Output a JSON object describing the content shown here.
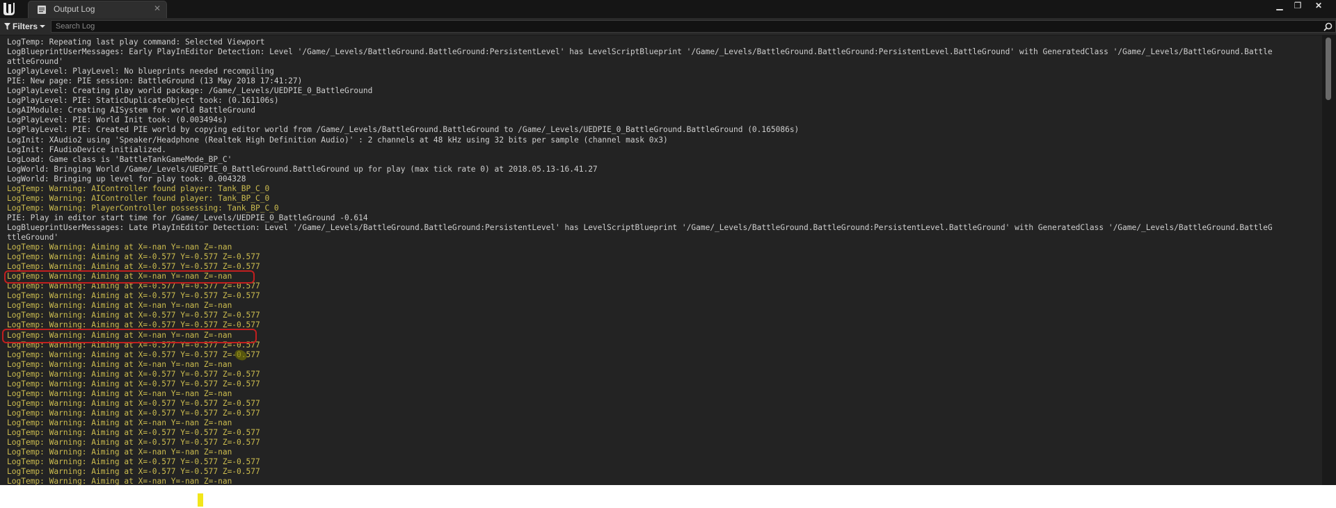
{
  "window": {
    "tab_title": "Output Log",
    "tab_close": "✕",
    "minimize": "▁",
    "restore": "❐",
    "close": "✕"
  },
  "toolbar": {
    "filters_label": "Filters",
    "search_placeholder": "Search Log"
  },
  "colors": {
    "background": "#232323",
    "normal_text": "#cfcfcf",
    "warning_text": "#cdbd4f",
    "highlight": "#c21f1f"
  },
  "log_lines": [
    {
      "text": "LogTemp: Repeating last play command: Selected Viewport",
      "level": "normal"
    },
    {
      "text": "LogBlueprintUserMessages: Early PlayInEditor Detection: Level '/Game/_Levels/BattleGround.BattleGround:PersistentLevel' has LevelScriptBlueprint '/Game/_Levels/BattleGround.BattleGround:PersistentLevel.BattleGround' with GeneratedClass '/Game/_Levels/BattleGround.Battle",
      "level": "normal"
    },
    {
      "text": "attleGround'",
      "level": "normal"
    },
    {
      "text": "LogPlayLevel: PlayLevel: No blueprints needed recompiling",
      "level": "normal"
    },
    {
      "text": "PIE: New page: PIE session: BattleGround (13 May 2018 17:41:27)",
      "level": "normal"
    },
    {
      "text": "LogPlayLevel: Creating play world package: /Game/_Levels/UEDPIE_0_BattleGround",
      "level": "normal"
    },
    {
      "text": "LogPlayLevel: PIE: StaticDuplicateObject took: (0.161106s)",
      "level": "normal"
    },
    {
      "text": "LogAIModule: Creating AISystem for world BattleGround",
      "level": "normal"
    },
    {
      "text": "LogPlayLevel: PIE: World Init took: (0.003494s)",
      "level": "normal"
    },
    {
      "text": "LogPlayLevel: PIE: Created PIE world by copying editor world from /Game/_Levels/BattleGround.BattleGround to /Game/_Levels/UEDPIE_0_BattleGround.BattleGround (0.165086s)",
      "level": "normal"
    },
    {
      "text": "LogInit: XAudio2 using 'Speaker/Headphone (Realtek High Definition Audio)' : 2 channels at 48 kHz using 32 bits per sample (channel mask 0x3)",
      "level": "normal"
    },
    {
      "text": "LogInit: FAudioDevice initialized.",
      "level": "normal"
    },
    {
      "text": "LogLoad: Game class is 'BattleTankGameMode_BP_C'",
      "level": "normal"
    },
    {
      "text": "LogWorld: Bringing World /Game/_Levels/UEDPIE_0_BattleGround.BattleGround up for play (max tick rate 0) at 2018.05.13-16.41.27",
      "level": "normal"
    },
    {
      "text": "LogWorld: Bringing up level for play took: 0.004328",
      "level": "normal"
    },
    {
      "text": "LogTemp: Warning: AIController found player: Tank_BP_C_0",
      "level": "warning"
    },
    {
      "text": "LogTemp: Warning: AIController found player: Tank_BP_C_0",
      "level": "warning"
    },
    {
      "text": "LogTemp: Warning: PlayerController possessing: Tank_BP_C_0",
      "level": "warning"
    },
    {
      "text": "PIE: Play in editor start time for /Game/_Levels/UEDPIE_0_BattleGround -0.614",
      "level": "normal"
    },
    {
      "text": "LogBlueprintUserMessages: Late PlayInEditor Detection: Level '/Game/_Levels/BattleGround.BattleGround:PersistentLevel' has LevelScriptBlueprint '/Game/_Levels/BattleGround.BattleGround:PersistentLevel.BattleGround' with GeneratedClass '/Game/_Levels/BattleGround.BattleG",
      "level": "normal"
    },
    {
      "text": "ttleGround'",
      "level": "normal"
    },
    {
      "text": "LogTemp: Warning: Aiming at X=-nan Y=-nan Z=-nan",
      "level": "warning"
    },
    {
      "text": "LogTemp: Warning: Aiming at X=-0.577 Y=-0.577 Z=-0.577",
      "level": "warning"
    },
    {
      "text": "LogTemp: Warning: Aiming at X=-0.577 Y=-0.577 Z=-0.577",
      "level": "warning"
    },
    {
      "text": "LogTemp: Warning: Aiming at X=-nan Y=-nan Z=-nan",
      "level": "warning"
    },
    {
      "text": "LogTemp: Warning: Aiming at X=-0.577 Y=-0.577 Z=-0.577",
      "level": "warning"
    },
    {
      "text": "LogTemp: Warning: Aiming at X=-0.577 Y=-0.577 Z=-0.577",
      "level": "warning"
    },
    {
      "text": "LogTemp: Warning: Aiming at X=-nan Y=-nan Z=-nan",
      "level": "warning"
    },
    {
      "text": "LogTemp: Warning: Aiming at X=-0.577 Y=-0.577 Z=-0.577",
      "level": "warning"
    },
    {
      "text": "LogTemp: Warning: Aiming at X=-0.577 Y=-0.577 Z=-0.577",
      "level": "warning"
    },
    {
      "text": "LogTemp: Warning: Aiming at X=-nan Y=-nan Z=-nan",
      "level": "warning"
    },
    {
      "text": "LogTemp: Warning: Aiming at X=-0.577 Y=-0.577 Z=-0.577",
      "level": "warning"
    },
    {
      "text": "LogTemp: Warning: Aiming at X=-0.577 Y=-0.577 Z=-0.577",
      "level": "warning"
    },
    {
      "text": "LogTemp: Warning: Aiming at X=-nan Y=-nan Z=-nan",
      "level": "warning"
    },
    {
      "text": "LogTemp: Warning: Aiming at X=-0.577 Y=-0.577 Z=-0.577",
      "level": "warning"
    },
    {
      "text": "LogTemp: Warning: Aiming at X=-0.577 Y=-0.577 Z=-0.577",
      "level": "warning"
    },
    {
      "text": "LogTemp: Warning: Aiming at X=-nan Y=-nan Z=-nan",
      "level": "warning"
    },
    {
      "text": "LogTemp: Warning: Aiming at X=-0.577 Y=-0.577 Z=-0.577",
      "level": "warning"
    },
    {
      "text": "LogTemp: Warning: Aiming at X=-0.577 Y=-0.577 Z=-0.577",
      "level": "warning"
    },
    {
      "text": "LogTemp: Warning: Aiming at X=-nan Y=-nan Z=-nan",
      "level": "warning"
    },
    {
      "text": "LogTemp: Warning: Aiming at X=-0.577 Y=-0.577 Z=-0.577",
      "level": "warning"
    },
    {
      "text": "LogTemp: Warning: Aiming at X=-0.577 Y=-0.577 Z=-0.577",
      "level": "warning"
    },
    {
      "text": "LogTemp: Warning: Aiming at X=-nan Y=-nan Z=-nan",
      "level": "warning"
    },
    {
      "text": "LogTemp: Warning: Aiming at X=-0.577 Y=-0.577 Z=-0.577",
      "level": "warning"
    },
    {
      "text": "LogTemp: Warning: Aiming at X=-0.577 Y=-0.577 Z=-0.577",
      "level": "warning"
    },
    {
      "text": "LogTemp: Warning: Aiming at X=-nan Y=-nan Z=-nan",
      "level": "warning"
    }
  ]
}
